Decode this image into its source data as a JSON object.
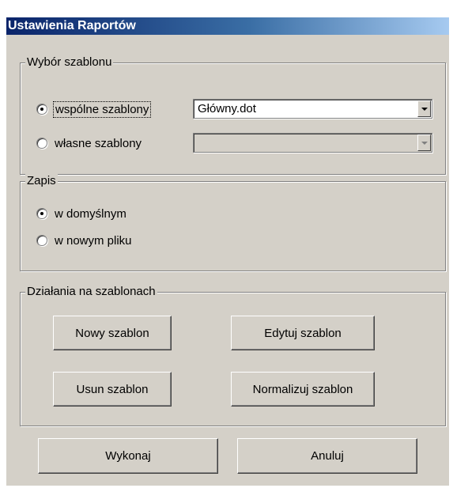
{
  "window": {
    "title": "Ustawienia Raportów"
  },
  "template_group": {
    "legend": "Wybór szablonu",
    "shared_option": {
      "label": "wspólne szablony",
      "selected": true
    },
    "shared_combo": {
      "value": "Główny.dot"
    },
    "own_option": {
      "label": "własne szablony",
      "selected": false
    },
    "own_combo": {
      "value": "",
      "disabled": true
    }
  },
  "save_group": {
    "legend": "Zapis",
    "default_option": {
      "label": "w domyślnym",
      "selected": true
    },
    "new_file_option": {
      "label": "w nowym pliku",
      "selected": false
    }
  },
  "actions_group": {
    "legend": "Działania na szablonach",
    "new_label": "Nowy szablon",
    "edit_label": "Edytuj szablon",
    "delete_label": "Usun szablon",
    "normalize_label": "Normalizuj szablon"
  },
  "footer": {
    "execute_label": "Wykonaj",
    "cancel_label": "Anuluj"
  }
}
